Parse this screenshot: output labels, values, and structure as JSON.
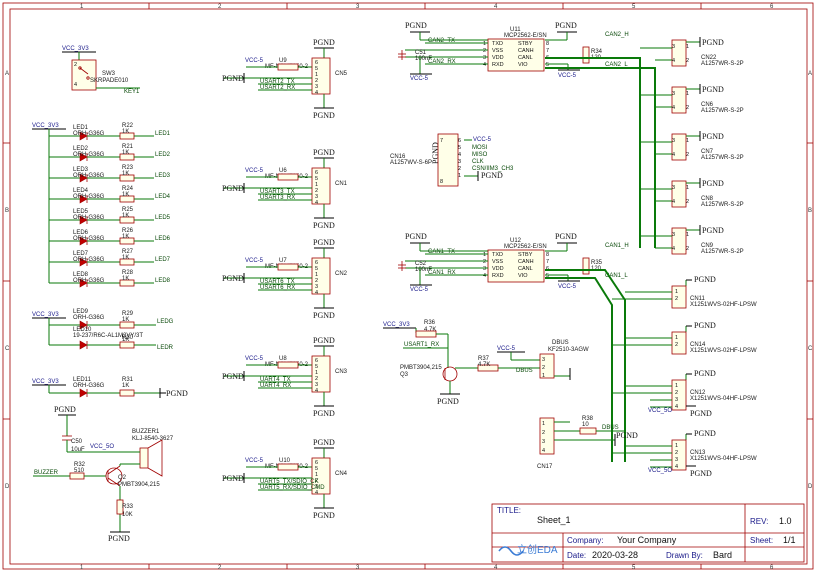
{
  "frame": {
    "cols": [
      "1",
      "2",
      "3",
      "4",
      "5",
      "6"
    ],
    "rows": [
      "A",
      "B",
      "C",
      "D"
    ]
  },
  "title_block": {
    "title_label": "TITLE:",
    "title": "Sheet_1",
    "rev_label": "REV:",
    "rev": "1.0",
    "company_label": "Company:",
    "company": "Your Company",
    "sheet_label": "Sheet:",
    "sheet": "1/1",
    "date_label": "Date:",
    "date": "2020-03-28",
    "drawn_label": "Drawn By:",
    "drawn": "Bard",
    "logo_text": "立创EDA"
  },
  "power": {
    "vcc33": "VCC_3V3",
    "vcc5": "VCC-5",
    "vcc_5o": "VCC_5O",
    "gnd": "PGND"
  },
  "switch": {
    "ref": "SW3",
    "part": "SKRPADE010",
    "net": "KEY1"
  },
  "leds": [
    {
      "ref": "LED1",
      "part": "ORH-G36G",
      "res": "R22",
      "val": "1K",
      "net": "LED1"
    },
    {
      "ref": "LED2",
      "part": "ORH-G36G",
      "res": "R21",
      "val": "1K",
      "net": "LED2"
    },
    {
      "ref": "LED3",
      "part": "ORH-G36G",
      "res": "R23",
      "val": "1K",
      "net": "LED3"
    },
    {
      "ref": "LED4",
      "part": "ORH-G36G",
      "res": "R24",
      "val": "1K",
      "net": "LED4"
    },
    {
      "ref": "LED5",
      "part": "ORH-G36G",
      "res": "R25",
      "val": "1K",
      "net": "LED5"
    },
    {
      "ref": "LED6",
      "part": "ORH-G36G",
      "res": "R26",
      "val": "1K",
      "net": "LED6"
    },
    {
      "ref": "LED7",
      "part": "ORH-G36G",
      "res": "R27",
      "val": "1K",
      "net": "LED7"
    },
    {
      "ref": "LED8",
      "part": "ORH-G36G",
      "res": "R28",
      "val": "1K",
      "net": "LED8"
    }
  ],
  "led_rg": {
    "ref9": "LED9",
    "part9": "ORH-G36G",
    "ref10": "LED10",
    "part10": "19-237/R6C-AL1M2VY/3T",
    "r29": "R29",
    "r30": "R30",
    "val": "1K",
    "net_g": "LEDG",
    "net_r": "LEDR"
  },
  "led11": {
    "ref": "LED11",
    "part": "ORH-G36G",
    "res": "R31",
    "val": "1K"
  },
  "buzzer": {
    "cap": "C50",
    "cap_val": "10uF",
    "ref": "BUZZER1",
    "part": "KLJ-8540-3627",
    "net": "BUZZER",
    "r32": "R32",
    "r32_val": "510",
    "q": "Q2",
    "q_part": "PMBT3904,215",
    "r33": "R33",
    "r33_val": "10K"
  },
  "usarts": [
    {
      "u": "U9",
      "part": "MF-NSMF050-2",
      "cn": "CN5",
      "tx": "USART2_TX",
      "rx": "USART2_RX"
    },
    {
      "u": "U6",
      "part": "MF-NSMF050-2",
      "cn": "CN1",
      "tx": "USART3_TX",
      "rx": "USART3_RX"
    },
    {
      "u": "U7",
      "part": "MF-NSMF050-2",
      "cn": "CN2",
      "tx": "USART6_TX",
      "rx": "USART6_RX"
    },
    {
      "u": "U8",
      "part": "MF-NSMF050-2",
      "cn": "CN3",
      "tx": "UART4_TX",
      "rx": "UART4_RX"
    },
    {
      "u": "U10",
      "part": "MF-NSMF050-2",
      "cn": "CN4",
      "tx": "UART5_TX/SDIO_CK",
      "rx": "UART5_RX/SDIO_CMD"
    }
  ],
  "can2": {
    "u": "U11",
    "part": "MCP2562-E/SN",
    "cap": "C51",
    "cap_val": "100nF",
    "in_tx": "CAN2_TX",
    "in_rx": "CAN2_RX",
    "r": "R34",
    "r_val": "120",
    "h": "CAN2_H",
    "l": "CAN2_L",
    "pins_l": [
      "TXD",
      "VSS",
      "VDD",
      "RXD"
    ],
    "pins_r": [
      "STBY",
      "CANH",
      "CANL",
      "VIO"
    ],
    "nums_l": [
      "1",
      "2",
      "3",
      "4"
    ],
    "nums_r": [
      "8",
      "7",
      "6",
      "5"
    ]
  },
  "can1": {
    "u": "U12",
    "part": "MCP2562-E/SN",
    "cap": "C52",
    "cap_val": "100nF",
    "in_tx": "CAN1_TX",
    "in_rx": "CAN1_RX",
    "r": "R35",
    "r_val": "120",
    "h": "CAN1_H",
    "l": "CAN1_L",
    "pins_l": [
      "TXD",
      "VSS",
      "VDD",
      "RXD"
    ],
    "pins_r": [
      "STBY",
      "CANH",
      "CANL",
      "VIO"
    ],
    "nums_l": [
      "1",
      "2",
      "3",
      "4"
    ],
    "nums_r": [
      "8",
      "7",
      "6",
      "5"
    ]
  },
  "spi": {
    "cn": "CN16",
    "part": "A1257WV-S-6P",
    "pins": [
      "MOSI",
      "MISO",
      "CLK",
      "CSN/IIM3_CH3"
    ]
  },
  "can_conns": [
    {
      "cn": "CN22",
      "part": "A1257WR-S-2P"
    },
    {
      "cn": "CN6",
      "part": "A1257WR-S-2P"
    },
    {
      "cn": "CN7",
      "part": "A1257WR-S-2P"
    },
    {
      "cn": "CN8",
      "part": "A1257WR-S-2P"
    },
    {
      "cn": "CN9",
      "part": "A1257WR-S-2P"
    }
  ],
  "dbus": {
    "r36": "R36",
    "r36_val": "4.7K",
    "net_in": "USART1_RX",
    "r37": "R37",
    "r37_val": "4.7K",
    "q": "Q3",
    "q_part": "PMBT3904,215",
    "cn": "DBUS",
    "cn_part": "KF2510-3AGW",
    "net": "DBUS"
  },
  "cn17": {
    "cn": "CN17",
    "r": "R38",
    "r_val": "10",
    "net": "DBUS"
  },
  "x125": [
    {
      "cn": "CN11",
      "part": "X1251WVS-02HF-LPSW"
    },
    {
      "cn": "CN14",
      "part": "X1251WVS-02HF-LPSW"
    },
    {
      "cn": "CN12",
      "part": "X1251WVS-04HF-LPSW"
    },
    {
      "cn": "CN13",
      "part": "X1251WVS-04HF-LPSW"
    }
  ]
}
